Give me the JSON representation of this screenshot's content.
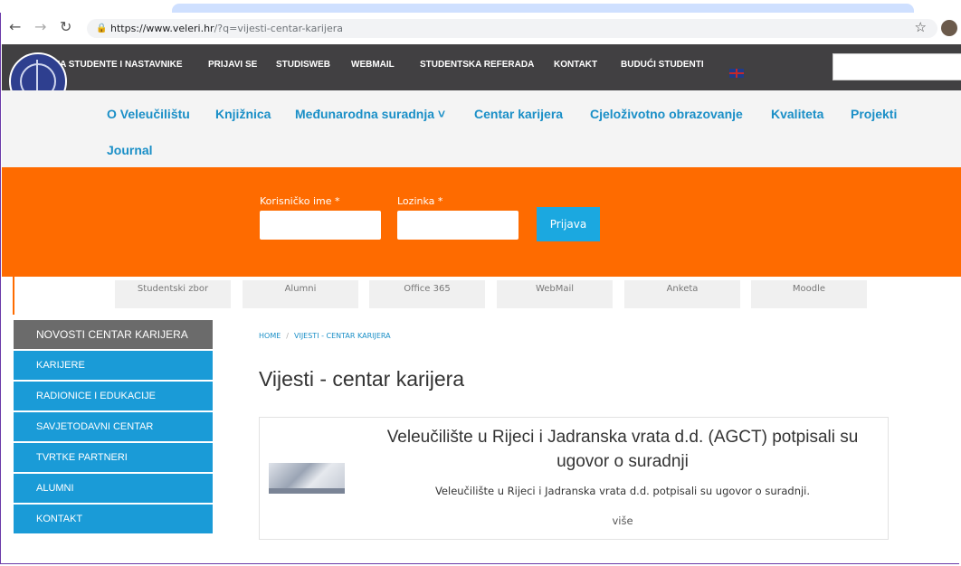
{
  "browser": {
    "url_host": "https://www.veleri.hr",
    "url_path": "/?q=vijesti-centar-karijera"
  },
  "topnav": {
    "items": [
      "ZA STUDENTE I NASTAVNIKE",
      "PRIJAVI SE",
      "STUDISWEB",
      "WEBMAIL",
      "STUDENTSKA REFERADA",
      "KONTAKT",
      "BUDUĆI STUDENTI"
    ]
  },
  "mainnav": {
    "items": [
      "O Veleučilištu",
      "Knjižnica",
      "Međunarodna suradnja ˅",
      "Centar karijera",
      "Cjeloživotno obrazovanje",
      "Kvaliteta",
      "Projekti",
      "Journal"
    ]
  },
  "login": {
    "username_label": "Korisničko ime *",
    "password_label": "Lozinka *",
    "button": "Prijava"
  },
  "quicklinks": [
    "Studentski zbor",
    "Alumni",
    "Office 365",
    "WebMail",
    "Anketa",
    "Moodle"
  ],
  "sidebar": {
    "items": [
      "NOVOSTI CENTAR KARIJERA",
      "KARIJERE",
      "RADIONICE I EDUKACIJE",
      "SAVJETODAVNI CENTAR",
      "TVRTKE PARTNERI",
      "ALUMNI",
      "KONTAKT"
    ]
  },
  "breadcrumb": {
    "home": "HOME",
    "sep": "/",
    "current": "VIJESTI - CENTAR KARIJERA"
  },
  "page_title": "Vijesti - centar karijera",
  "article": {
    "title": "Veleučilište u Rijeci i Jadranska vrata d.d. (AGCT) potpisali su ugovor o suradnji",
    "description": "Veleučilište u Rijeci i Jadranska vrata d.d. potpisali su ugovor o suradnji.",
    "more": "više"
  },
  "colors": {
    "orange": "#fe6b00",
    "blue": "#1a9bd7",
    "dark": "#414042"
  }
}
